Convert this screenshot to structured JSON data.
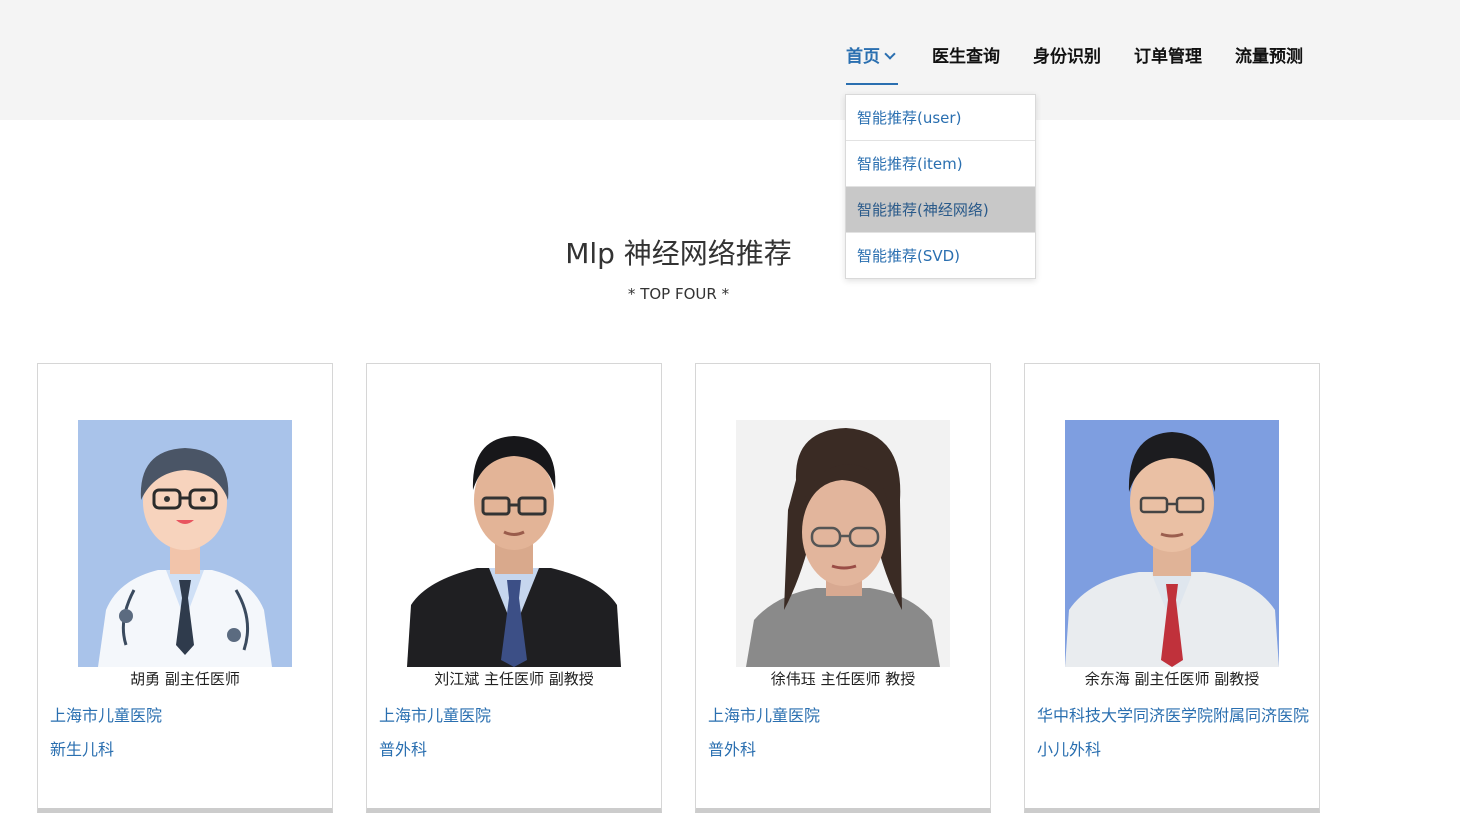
{
  "nav": {
    "items": [
      {
        "label": "首页",
        "active": true
      },
      {
        "label": "医生查询"
      },
      {
        "label": "身份识别"
      },
      {
        "label": "订单管理"
      },
      {
        "label": "流量预测"
      }
    ],
    "dropdown": [
      {
        "label": "智能推荐(user)"
      },
      {
        "label": "智能推荐(item)"
      },
      {
        "label": "智能推荐(神经网络)",
        "highlighted": true
      },
      {
        "label": "智能推荐(SVD)"
      }
    ]
  },
  "main": {
    "title": "Mlp 神经网络推荐",
    "subtitle": "* TOP FOUR *"
  },
  "cards": [
    {
      "name": "胡勇 副主任医师",
      "hospital": "上海市儿童医院",
      "department": "新生儿科",
      "photo": "cartoon-doctor-avatar"
    },
    {
      "name": "刘江斌 主任医师  副教授",
      "hospital": "上海市儿童医院",
      "department": "普外科",
      "photo": "doctor-photo-male-suit"
    },
    {
      "name": "徐伟珏 主任医师  教授",
      "hospital": "上海市儿童医院",
      "department": "普外科",
      "photo": "doctor-photo-female"
    },
    {
      "name": "余东海 副主任医师  副教授",
      "hospital": "华中科技大学同济医学院附属同济医院",
      "department": "小儿外科",
      "photo": "doctor-photo-male-whitecoat"
    }
  ],
  "colors": {
    "accent": "#2a6fb0",
    "header_bg": "#f4f4f4",
    "dropdown_hover": "#c8c8c8"
  }
}
